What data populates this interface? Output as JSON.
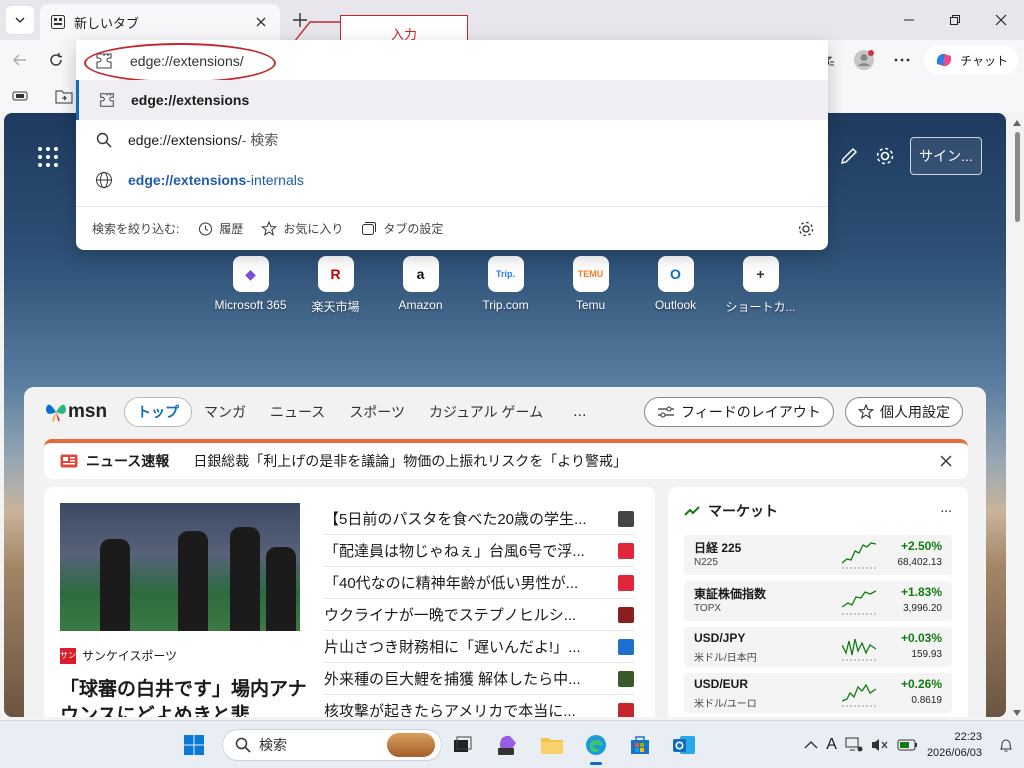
{
  "browser": {
    "tab": {
      "title": "新しいタブ"
    },
    "address": {
      "value": "edge://extensions/"
    },
    "copilot_label": "チャット"
  },
  "annotation": {
    "callout_text": "入力"
  },
  "omnibox": {
    "suggestions": [
      {
        "bold": "edge://extensions",
        "rest": "",
        "icon": "extension-icon"
      },
      {
        "bold": "",
        "rest": "edge://extensions/",
        "suffix": " - 検索",
        "icon": "search-icon"
      },
      {
        "bold": "edge://extensions",
        "rest": "-internals",
        "icon": "globe-icon"
      }
    ],
    "filter": {
      "label": "検索を絞り込む:",
      "items": [
        "履歴",
        "お気に入り",
        "タブの設定"
      ]
    }
  },
  "ntp": {
    "signin_label": "サイン...",
    "quick_links": [
      {
        "label": "Microsoft 365",
        "glyph": "◆",
        "color": "#7b4fd6"
      },
      {
        "label": "楽天市場",
        "glyph": "R",
        "color": "#bf0000"
      },
      {
        "label": "Amazon",
        "glyph": "a",
        "color": "#111111"
      },
      {
        "label": "Trip.com",
        "glyph": "Trip.",
        "color": "#287dfa"
      },
      {
        "label": "Temu",
        "glyph": "TEMU",
        "color": "#f57c1f"
      },
      {
        "label": "Outlook",
        "glyph": "O",
        "color": "#0f6cbd"
      },
      {
        "label": "ショートカ...",
        "glyph": "+",
        "color": "#333333"
      }
    ]
  },
  "feed": {
    "logo": "msn",
    "tabs": [
      "トップ",
      "マンガ",
      "ニュース",
      "スポーツ",
      "カジュアル ゲーム"
    ],
    "more": "...",
    "layout_btn": "フィードのレイアウト",
    "personalize_btn": "個人用設定",
    "breaking": {
      "label": "ニュース速報",
      "text": "日銀総裁「利上げの是非を議論」物価の上振れリスクを「より警戒」"
    },
    "main_story": {
      "source": "サンケイスポーツ",
      "headline": "「球審の白井です」場内アナウンスにどよめきと悲"
    },
    "headlines": [
      {
        "text": "【5日前のパスタを食べた20歳の学生...",
        "src_color": "#444444"
      },
      {
        "text": "「配達員は物じゃねぇ」台風6号で浮...",
        "src_color": "#e0263a"
      },
      {
        "text": "「40代なのに精神年齢が低い男性が...",
        "src_color": "#e0263a"
      },
      {
        "text": "ウクライナが一晩でステプノヒルシ...",
        "src_color": "#8a1f1f"
      },
      {
        "text": "片山さつき財務相に「遅いんだよ!」...",
        "src_color": "#1f6fd1"
      },
      {
        "text": "外来種の巨大鯉を捕獲 解体したら中...",
        "src_color": "#3a5a2a"
      },
      {
        "text": "核攻撃が起きたらアメリカで本当に...",
        "src_color": "#c4262e"
      }
    ],
    "market": {
      "title": "マーケット",
      "more": "...",
      "rows": [
        {
          "name": "日経 225",
          "sub": "N225",
          "change": "+2.50%",
          "value": "68,402.13"
        },
        {
          "name": "東証株価指数",
          "sub": "TOPX",
          "change": "+1.83%",
          "value": "3,996.20"
        },
        {
          "name": "USD/JPY",
          "sub": "米ドル/日本円",
          "change": "+0.03%",
          "value": "159.93"
        },
        {
          "name": "USD/EUR",
          "sub": "米ドル/ユーロ",
          "change": "+0.26%",
          "value": "0.8619"
        }
      ]
    }
  },
  "taskbar": {
    "search_placeholder": "検索",
    "ime": "A",
    "time": "22:23",
    "date": "2026/06/03"
  }
}
